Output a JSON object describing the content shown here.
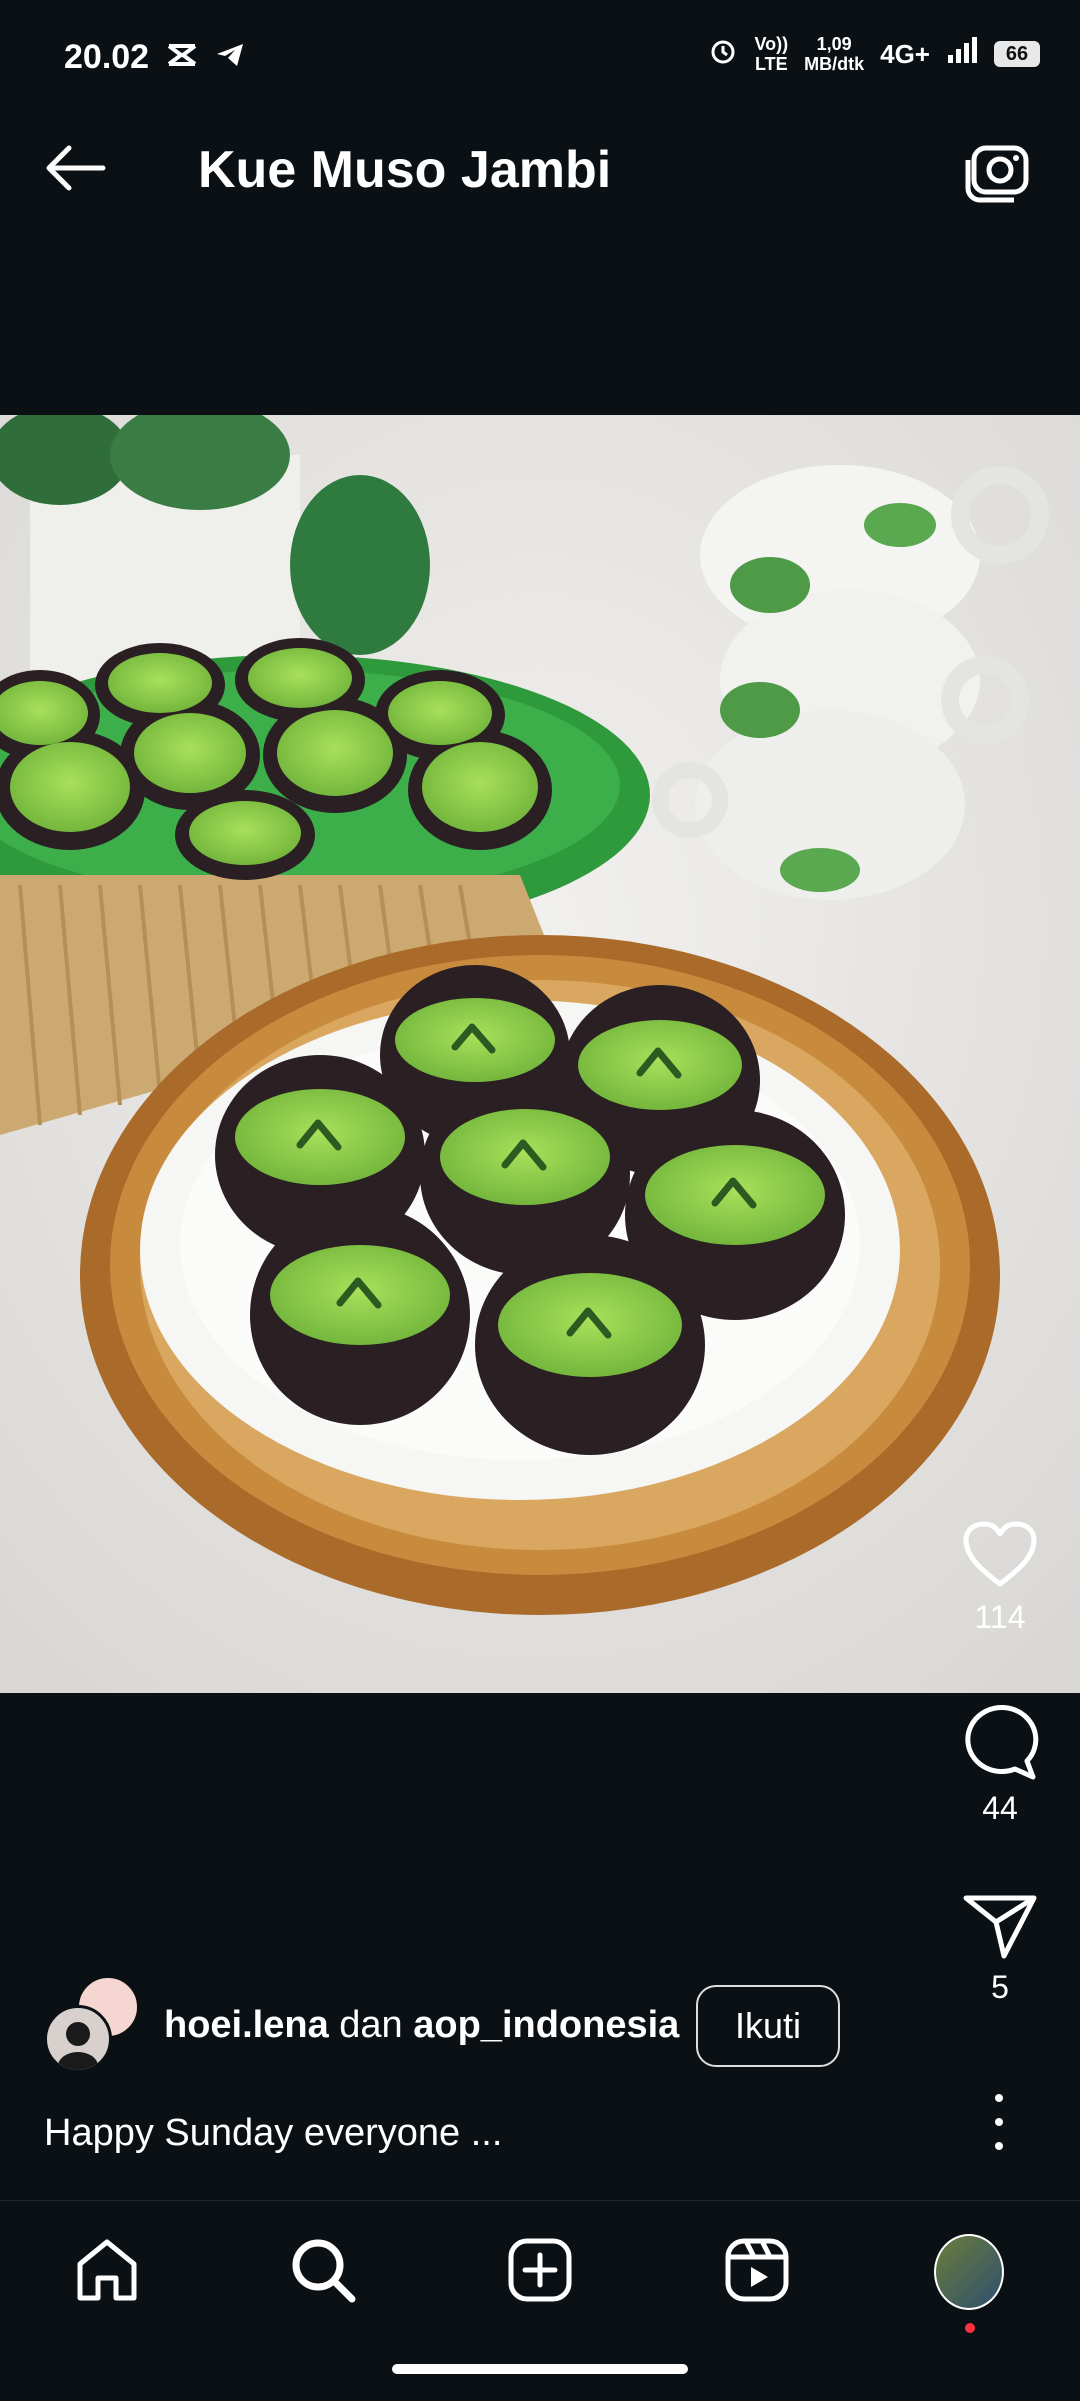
{
  "status_bar": {
    "time": "20.02",
    "speed_value": "1,09",
    "speed_unit": "MB/dtk",
    "network": "4G+",
    "battery": "66",
    "volte_top": "Vo))",
    "volte_bottom": "LTE"
  },
  "header": {
    "title": "Kue Muso Jambi"
  },
  "post": {
    "likes": "114",
    "comments": "44",
    "shares": "5",
    "author_primary": "hoei.lena",
    "author_joiner": "dan",
    "author_secondary": "aop_indonesia",
    "follow_label": "Ikuti",
    "caption": "Happy Sunday everyone ..."
  },
  "colors": {
    "background": "#0b1014",
    "cake_green": "#8fd14f",
    "cake_dark": "#2a1f22"
  },
  "icons": [
    "back-arrow-icon",
    "camera-icon",
    "heart-icon",
    "comment-icon",
    "send-icon",
    "more-icon",
    "home-icon",
    "search-icon",
    "create-icon",
    "reels-icon",
    "alarm-icon",
    "signal-icon",
    "telegram-icon",
    "capcut-icon"
  ]
}
